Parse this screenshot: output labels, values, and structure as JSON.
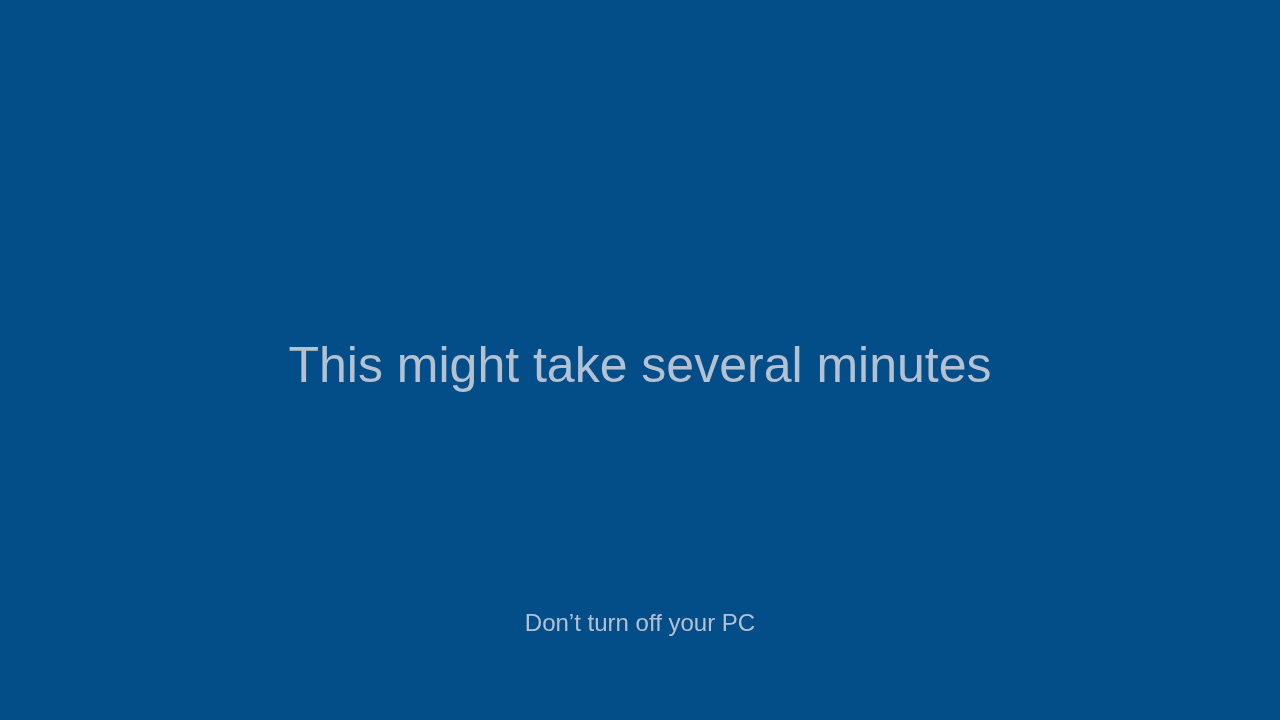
{
  "message": {
    "title": "This might take several minutes",
    "subtitle": "Don’t turn off your PC"
  }
}
